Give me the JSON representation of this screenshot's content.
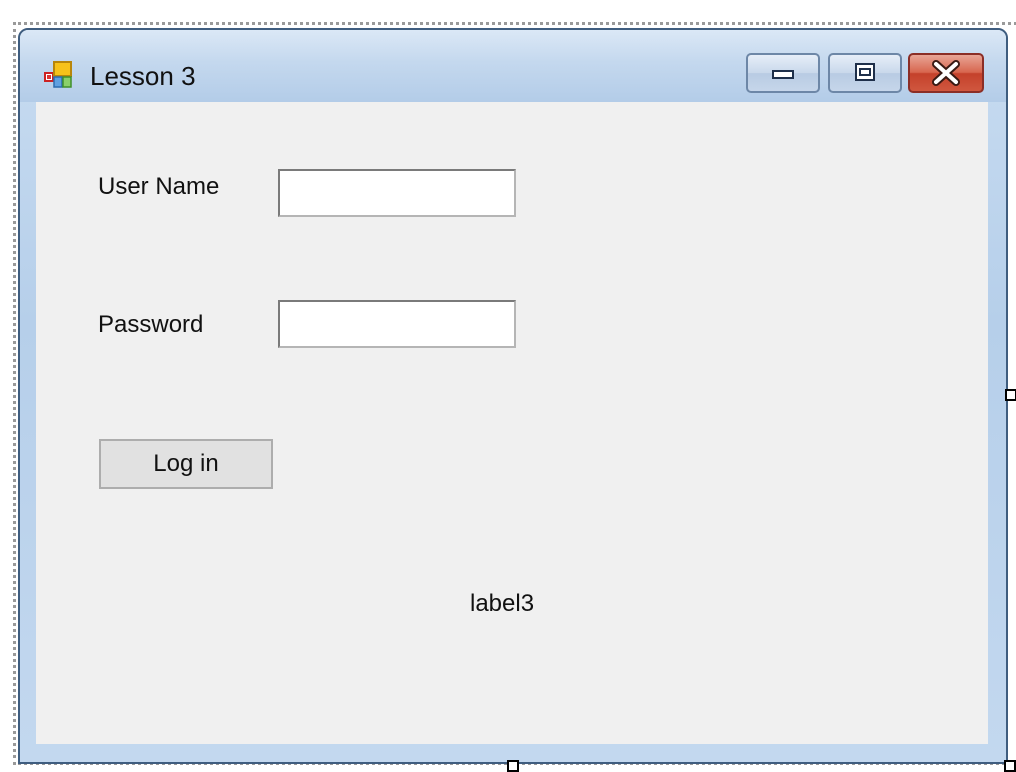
{
  "window": {
    "title": "Lesson 3",
    "icons": {
      "app": "windows-form-icon",
      "minimize": "minimize-icon",
      "maximize": "maximize-icon",
      "close": "close-icon"
    }
  },
  "form": {
    "username_label": "User Name",
    "username_value": "",
    "password_label": "Password",
    "password_value": "",
    "login_button_label": "Log in",
    "status_label": "label3"
  },
  "colors": {
    "titlebar": "#c4d8ee",
    "client_background": "#f0f0f0",
    "close_button": "#c4412b",
    "border": "#3f5d7f"
  }
}
